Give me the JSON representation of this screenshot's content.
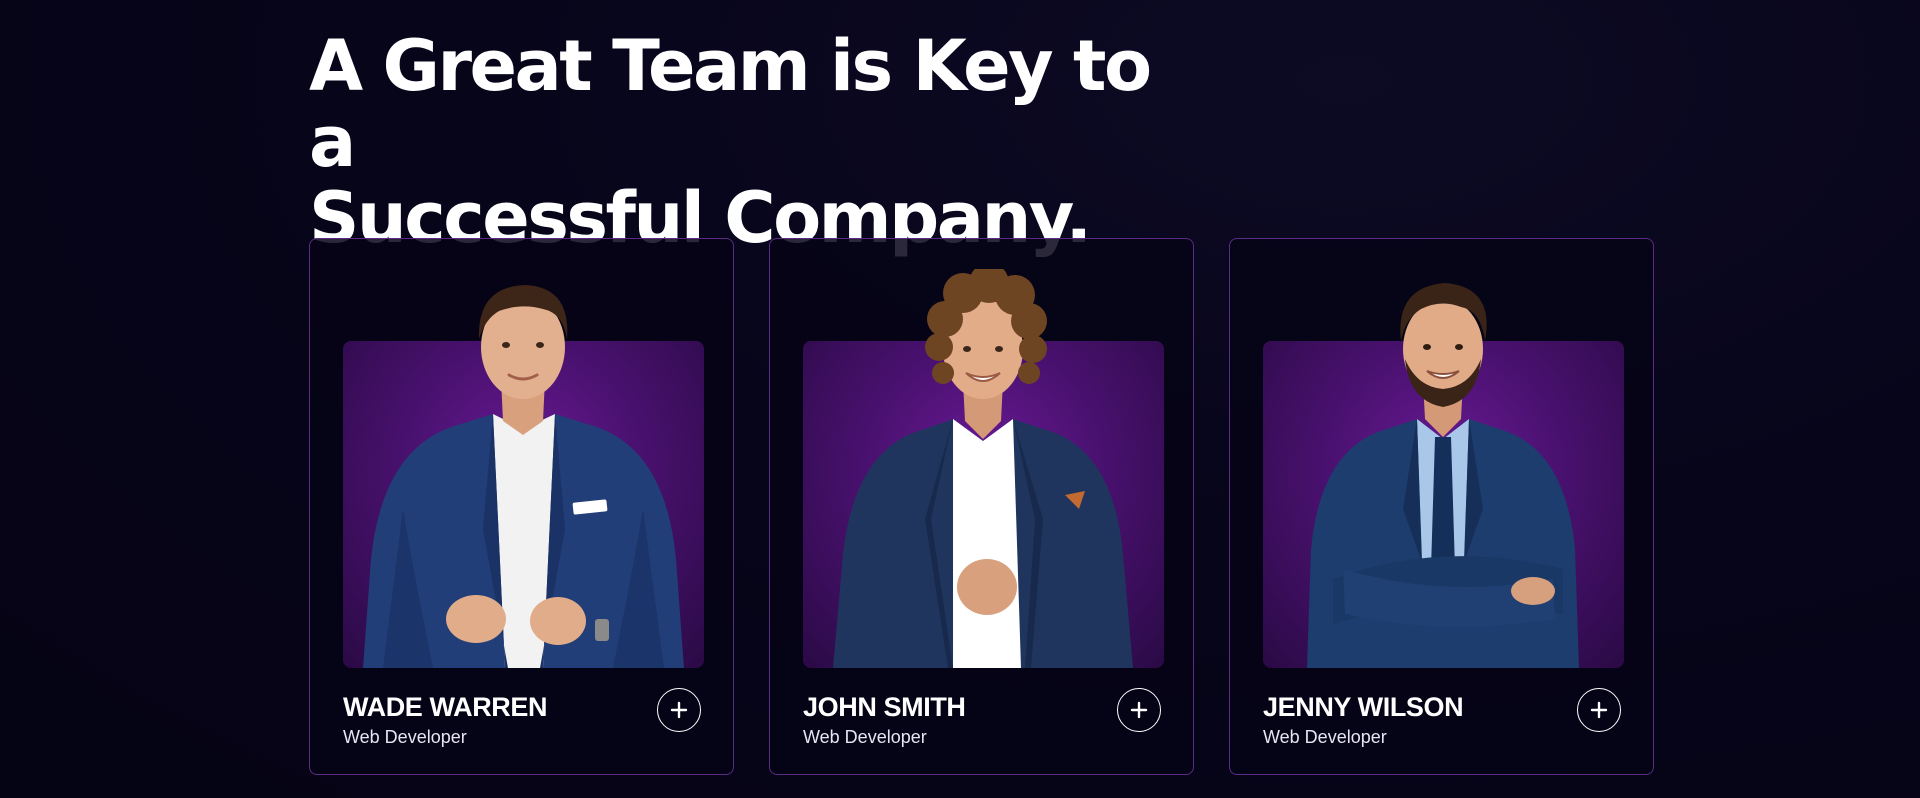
{
  "section": {
    "headline_line1": "A Great Team is Key to a",
    "headline_line2": "Successful Company."
  },
  "team": [
    {
      "name": "WADE WARREN",
      "role": "Web Developer",
      "hair": "short-brown",
      "jacket": "#213e78",
      "shirt": "#f2f2f2"
    },
    {
      "name": "JOHN SMITH",
      "role": "Web Developer",
      "hair": "curly",
      "jacket": "#1f355e",
      "shirt": "#ffffff"
    },
    {
      "name": "JENNY WILSON",
      "role": "Web Developer",
      "hair": "short-dark",
      "jacket": "#1c3d6e",
      "shirt": "#a9c7e8"
    }
  ],
  "colors": {
    "background": "#07051a",
    "card_border": "#5b2a86",
    "panel": "#5a1585",
    "text": "#ffffff"
  },
  "icons": {
    "expand_button": "plus-icon"
  }
}
